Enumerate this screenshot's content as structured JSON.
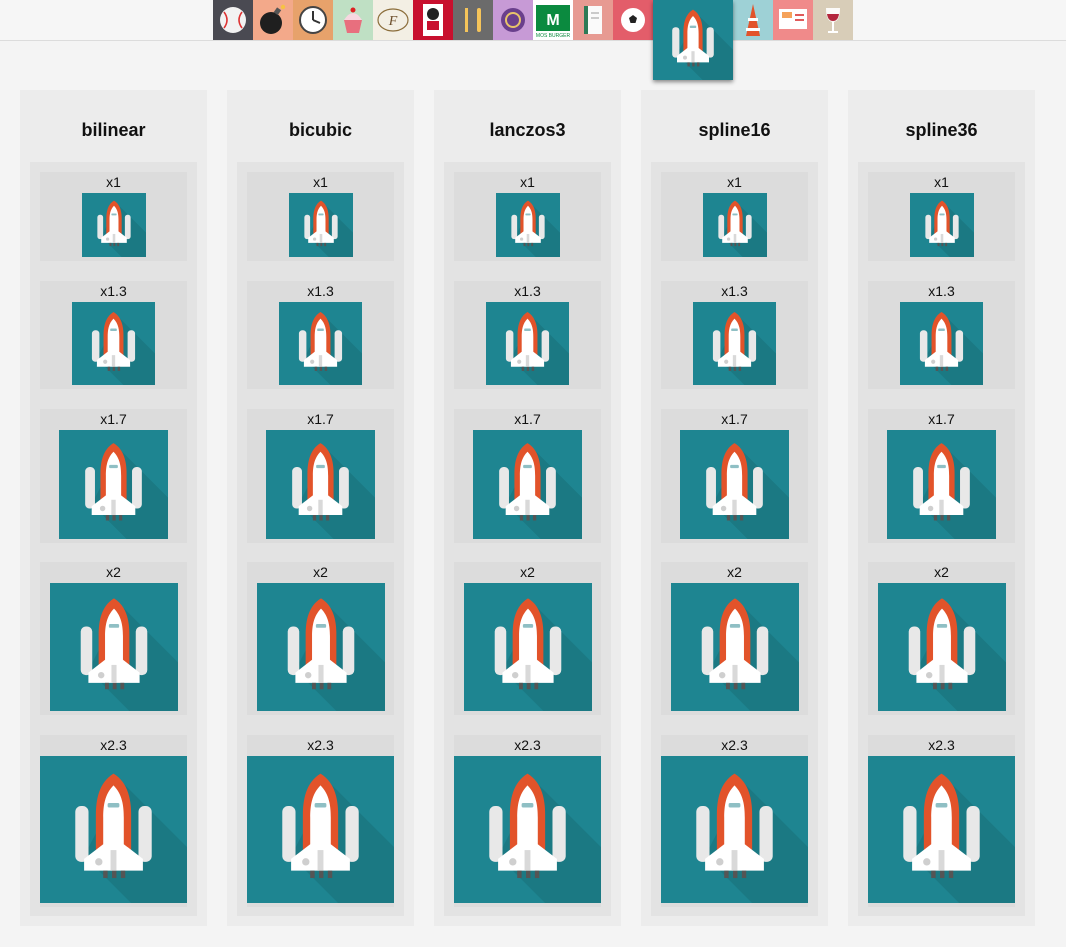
{
  "toolbar": {
    "icons": [
      {
        "name": "baseball-icon",
        "bg": "#4a4a52"
      },
      {
        "name": "bomb-icon",
        "bg": "#f3a98a"
      },
      {
        "name": "clock-icon",
        "bg": "#e7a26b"
      },
      {
        "name": "cupcake-icon",
        "bg": "#bfe0c4"
      },
      {
        "name": "fauchon-logo-icon",
        "bg": "#f3efe4"
      },
      {
        "name": "kfc-logo-icon",
        "bg": "#c8102e"
      },
      {
        "name": "fork-knife-icon",
        "bg": "#6b6b6b"
      },
      {
        "name": "coin-icon",
        "bg": "#c79ad6"
      },
      {
        "name": "mos-burger-logo-icon",
        "bg": "#0b8a3f"
      },
      {
        "name": "notebook-icon",
        "bg": "#e79a92"
      },
      {
        "name": "soccer-ball-icon",
        "bg": "#e35d6a"
      },
      {
        "name": "space-shuttle-icon",
        "bg": "#1e8591",
        "selected": true
      },
      {
        "name": "tokyo-tower-icon",
        "bg": "#9ed1d6"
      },
      {
        "name": "presentation-icon",
        "bg": "#f08a8a"
      },
      {
        "name": "wine-glass-icon",
        "bg": "#d8cdb8"
      }
    ],
    "selected_icon": "space-shuttle-icon",
    "logo_texts": {
      "mos": "MOS BURGER"
    }
  },
  "methods": [
    {
      "title": "bilinear"
    },
    {
      "title": "bicubic"
    },
    {
      "title": "lanczos3"
    },
    {
      "title": "spline16"
    },
    {
      "title": "spline36"
    }
  ],
  "scales": [
    {
      "label": "x1",
      "factor": 1
    },
    {
      "label": "x1.3",
      "factor": 1.3
    },
    {
      "label": "x1.7",
      "factor": 1.7
    },
    {
      "label": "x2",
      "factor": 2
    },
    {
      "label": "x2.3",
      "factor": 2.3
    }
  ],
  "colors": {
    "shuttle_bg": "#1e8591",
    "shuttle_shadow": "#1a6f79",
    "shuttle_body": "#ffffff",
    "shuttle_tank": "#e2532a",
    "booster": "#e8e8e8"
  }
}
